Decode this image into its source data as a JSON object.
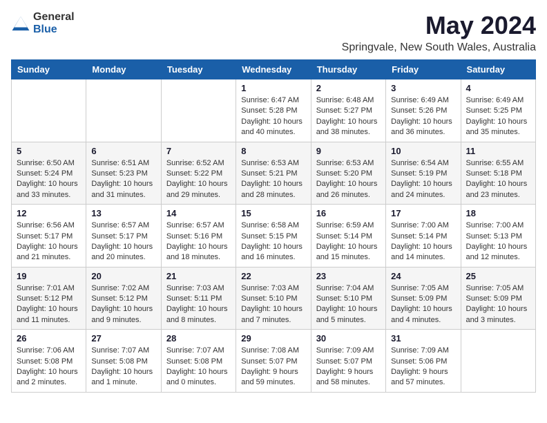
{
  "logo": {
    "text_general": "General",
    "text_blue": "Blue"
  },
  "title": "May 2024",
  "location": "Springvale, New South Wales, Australia",
  "weekdays": [
    "Sunday",
    "Monday",
    "Tuesday",
    "Wednesday",
    "Thursday",
    "Friday",
    "Saturday"
  ],
  "weeks": [
    [
      {
        "day": "",
        "info": ""
      },
      {
        "day": "",
        "info": ""
      },
      {
        "day": "",
        "info": ""
      },
      {
        "day": "1",
        "info": "Sunrise: 6:47 AM\nSunset: 5:28 PM\nDaylight: 10 hours and 40 minutes."
      },
      {
        "day": "2",
        "info": "Sunrise: 6:48 AM\nSunset: 5:27 PM\nDaylight: 10 hours and 38 minutes."
      },
      {
        "day": "3",
        "info": "Sunrise: 6:49 AM\nSunset: 5:26 PM\nDaylight: 10 hours and 36 minutes."
      },
      {
        "day": "4",
        "info": "Sunrise: 6:49 AM\nSunset: 5:25 PM\nDaylight: 10 hours and 35 minutes."
      }
    ],
    [
      {
        "day": "5",
        "info": "Sunrise: 6:50 AM\nSunset: 5:24 PM\nDaylight: 10 hours and 33 minutes."
      },
      {
        "day": "6",
        "info": "Sunrise: 6:51 AM\nSunset: 5:23 PM\nDaylight: 10 hours and 31 minutes."
      },
      {
        "day": "7",
        "info": "Sunrise: 6:52 AM\nSunset: 5:22 PM\nDaylight: 10 hours and 29 minutes."
      },
      {
        "day": "8",
        "info": "Sunrise: 6:53 AM\nSunset: 5:21 PM\nDaylight: 10 hours and 28 minutes."
      },
      {
        "day": "9",
        "info": "Sunrise: 6:53 AM\nSunset: 5:20 PM\nDaylight: 10 hours and 26 minutes."
      },
      {
        "day": "10",
        "info": "Sunrise: 6:54 AM\nSunset: 5:19 PM\nDaylight: 10 hours and 24 minutes."
      },
      {
        "day": "11",
        "info": "Sunrise: 6:55 AM\nSunset: 5:18 PM\nDaylight: 10 hours and 23 minutes."
      }
    ],
    [
      {
        "day": "12",
        "info": "Sunrise: 6:56 AM\nSunset: 5:17 PM\nDaylight: 10 hours and 21 minutes."
      },
      {
        "day": "13",
        "info": "Sunrise: 6:57 AM\nSunset: 5:17 PM\nDaylight: 10 hours and 20 minutes."
      },
      {
        "day": "14",
        "info": "Sunrise: 6:57 AM\nSunset: 5:16 PM\nDaylight: 10 hours and 18 minutes."
      },
      {
        "day": "15",
        "info": "Sunrise: 6:58 AM\nSunset: 5:15 PM\nDaylight: 10 hours and 16 minutes."
      },
      {
        "day": "16",
        "info": "Sunrise: 6:59 AM\nSunset: 5:14 PM\nDaylight: 10 hours and 15 minutes."
      },
      {
        "day": "17",
        "info": "Sunrise: 7:00 AM\nSunset: 5:14 PM\nDaylight: 10 hours and 14 minutes."
      },
      {
        "day": "18",
        "info": "Sunrise: 7:00 AM\nSunset: 5:13 PM\nDaylight: 10 hours and 12 minutes."
      }
    ],
    [
      {
        "day": "19",
        "info": "Sunrise: 7:01 AM\nSunset: 5:12 PM\nDaylight: 10 hours and 11 minutes."
      },
      {
        "day": "20",
        "info": "Sunrise: 7:02 AM\nSunset: 5:12 PM\nDaylight: 10 hours and 9 minutes."
      },
      {
        "day": "21",
        "info": "Sunrise: 7:03 AM\nSunset: 5:11 PM\nDaylight: 10 hours and 8 minutes."
      },
      {
        "day": "22",
        "info": "Sunrise: 7:03 AM\nSunset: 5:10 PM\nDaylight: 10 hours and 7 minutes."
      },
      {
        "day": "23",
        "info": "Sunrise: 7:04 AM\nSunset: 5:10 PM\nDaylight: 10 hours and 5 minutes."
      },
      {
        "day": "24",
        "info": "Sunrise: 7:05 AM\nSunset: 5:09 PM\nDaylight: 10 hours and 4 minutes."
      },
      {
        "day": "25",
        "info": "Sunrise: 7:05 AM\nSunset: 5:09 PM\nDaylight: 10 hours and 3 minutes."
      }
    ],
    [
      {
        "day": "26",
        "info": "Sunrise: 7:06 AM\nSunset: 5:08 PM\nDaylight: 10 hours and 2 minutes."
      },
      {
        "day": "27",
        "info": "Sunrise: 7:07 AM\nSunset: 5:08 PM\nDaylight: 10 hours and 1 minute."
      },
      {
        "day": "28",
        "info": "Sunrise: 7:07 AM\nSunset: 5:08 PM\nDaylight: 10 hours and 0 minutes."
      },
      {
        "day": "29",
        "info": "Sunrise: 7:08 AM\nSunset: 5:07 PM\nDaylight: 9 hours and 59 minutes."
      },
      {
        "day": "30",
        "info": "Sunrise: 7:09 AM\nSunset: 5:07 PM\nDaylight: 9 hours and 58 minutes."
      },
      {
        "day": "31",
        "info": "Sunrise: 7:09 AM\nSunset: 5:06 PM\nDaylight: 9 hours and 57 minutes."
      },
      {
        "day": "",
        "info": ""
      }
    ]
  ]
}
